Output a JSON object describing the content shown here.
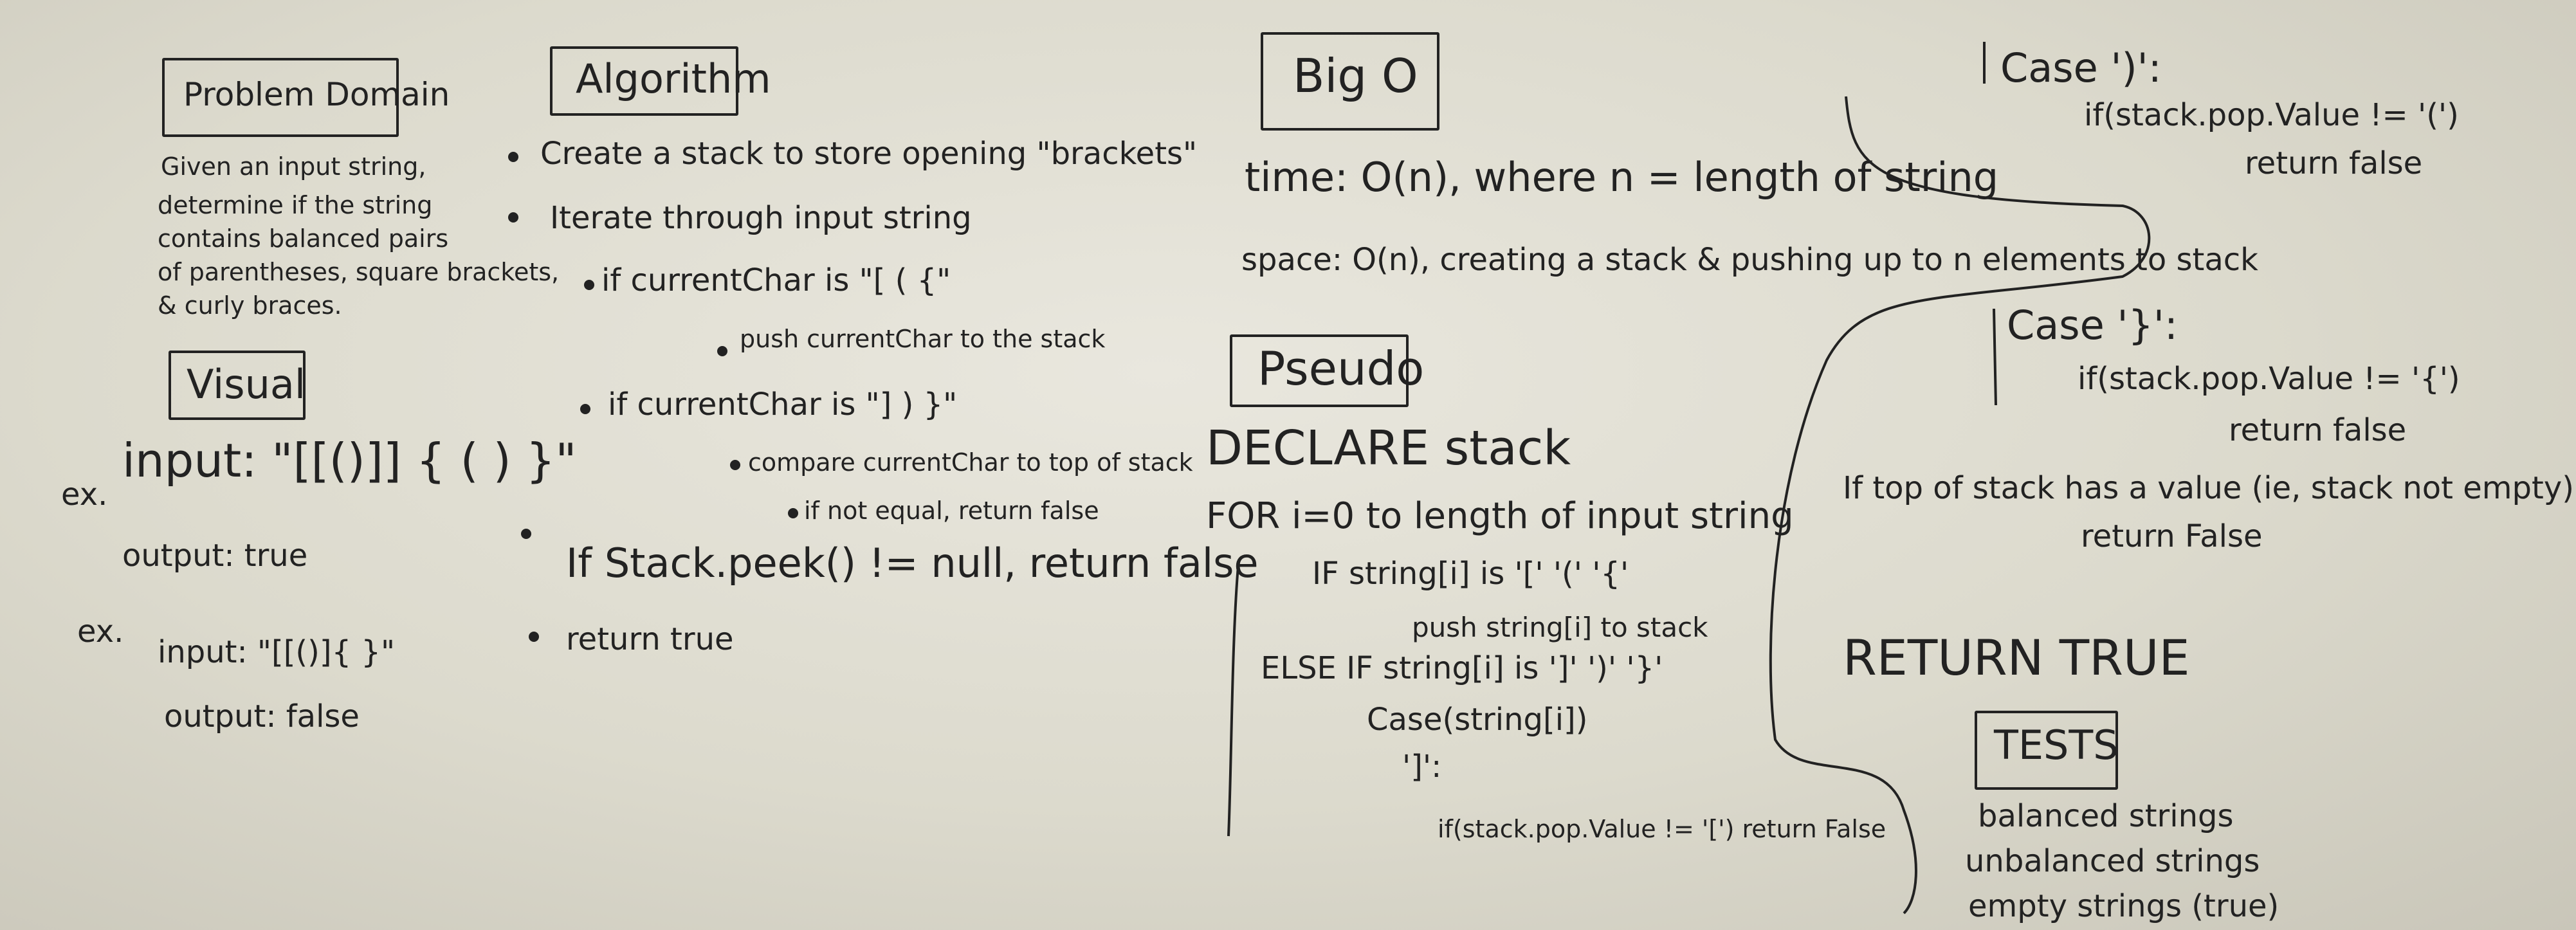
{
  "problem_domain": {
    "title": "Problem Domain",
    "lines": [
      "Given an input string,",
      "determine if the string",
      "contains balanced pairs",
      "of parentheses, square brackets,",
      "& curly braces."
    ]
  },
  "visual": {
    "title": "Visual",
    "ex1_label": "ex.",
    "ex1_input": "input: \"[[()]] { ( ) }\"",
    "ex1_output": "output: true",
    "ex2_label": "ex.",
    "ex2_input": "input: \"[[()]{ }\"",
    "ex2_output": "output: false"
  },
  "algorithm": {
    "title": "Algorithm",
    "steps": [
      "Create a stack to store opening \"brackets\"",
      "Iterate through input string",
      "if currentChar is \"[ ( {\"",
      "push currentChar to the stack",
      "if currentChar is \"] ) }\"",
      "compare currentChar to top of stack",
      "if not equal, return false",
      "If Stack.peek() != null, return false",
      "return true"
    ]
  },
  "big_o": {
    "title": "Big O",
    "time": "time: O(n), where n = length of string",
    "space": "space: O(n), creating a stack & pushing up to n elements to stack"
  },
  "pseudo": {
    "title": "Pseudo",
    "lines": [
      "DECLARE stack",
      "FOR i=0 to length of input string",
      "IF string[i] is '[' '(' '{'",
      "push string[i] to stack",
      "ELSE IF string[i] is ']' ')' '}'",
      "Case(string[i])",
      "']':",
      "if(stack.pop.Value != '[') return False"
    ]
  },
  "cases": {
    "case_paren": "Case ')':",
    "case_paren_cond": "if(stack.pop.Value != '(')",
    "case_paren_ret": "return false",
    "case_brace": "Case '}':",
    "case_brace_cond": "if(stack.pop.Value != '{')",
    "case_brace_ret": "return false",
    "if_top": "If top of stack has a value (ie, stack not empty)",
    "return_false": "return False",
    "return_true": "RETURN TRUE"
  },
  "tests": {
    "title": "TESTS",
    "items": [
      "balanced strings",
      "unbalanced strings",
      "empty strings (true)"
    ]
  }
}
